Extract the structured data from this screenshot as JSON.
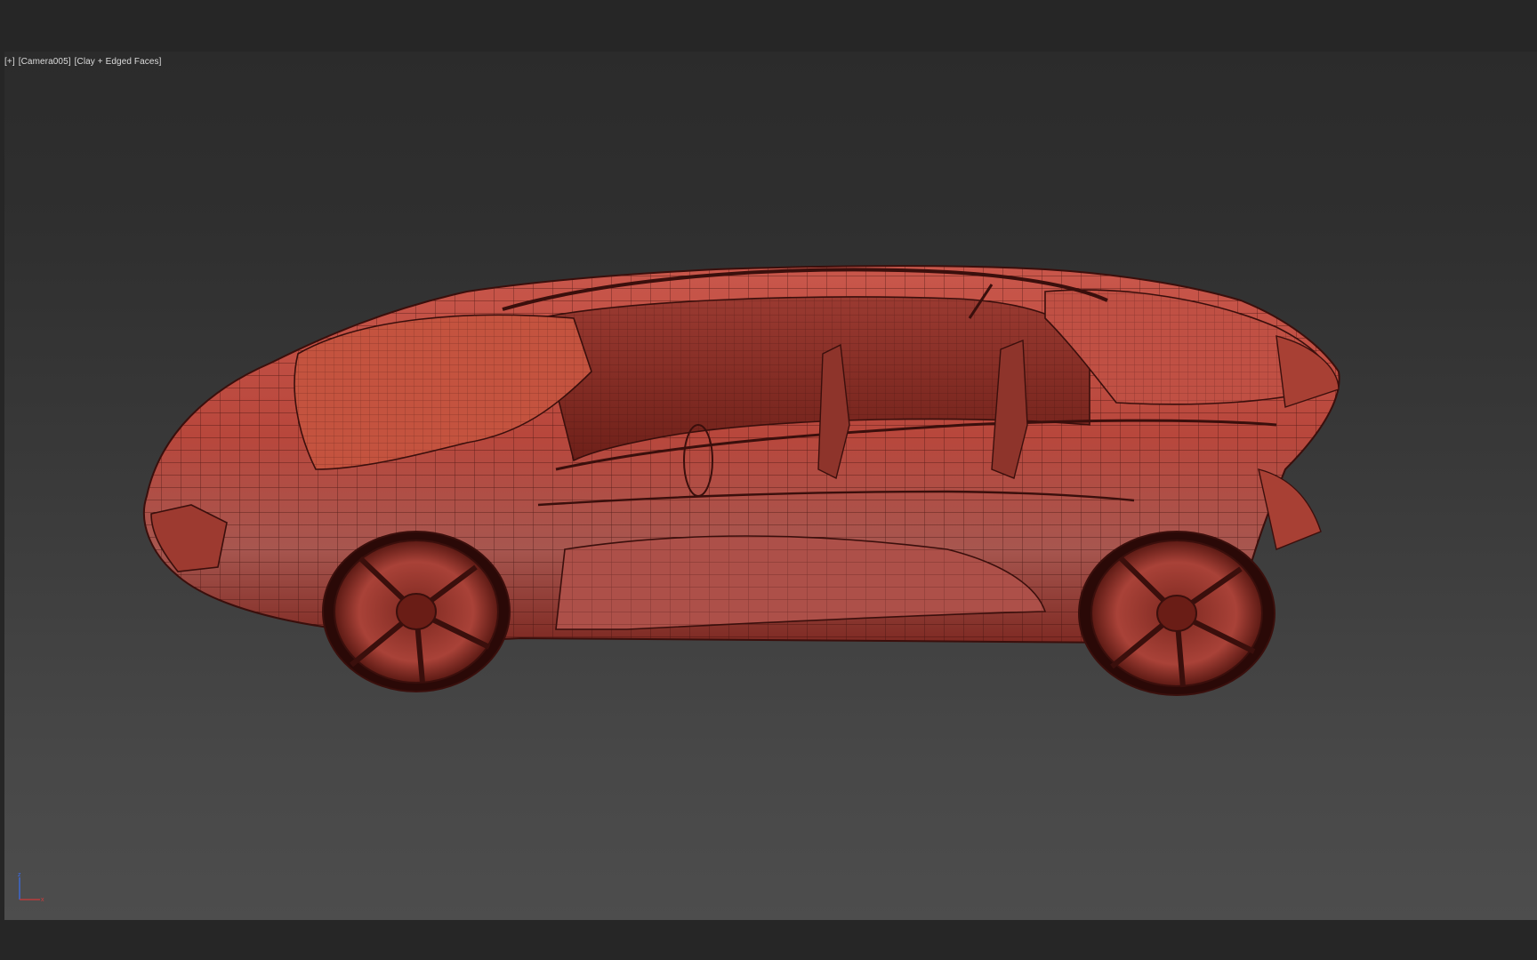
{
  "viewport": {
    "label_plus": "[+]",
    "label_camera": "[Camera005]",
    "label_shading": "[Clay + Edged Faces]"
  },
  "model": {
    "description_icon": "wireframe-car",
    "clay_color": "#b8473c",
    "edge_color": "#3a0f0c"
  },
  "axis": {
    "z_label": "z",
    "x_label": "x",
    "z_color": "#3a6df0",
    "x_color": "#d03a3a"
  }
}
